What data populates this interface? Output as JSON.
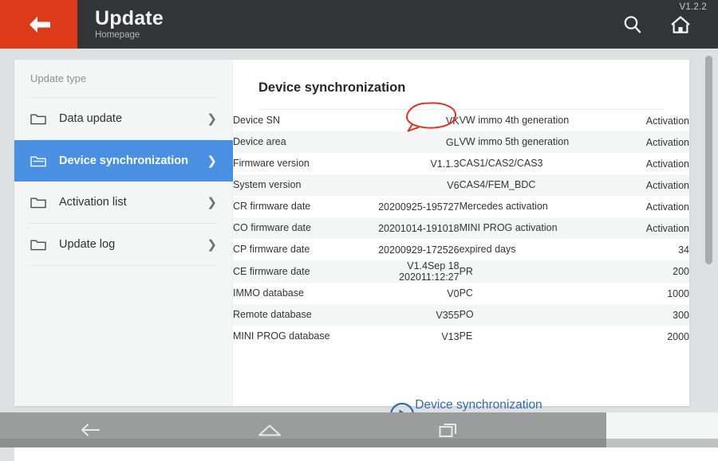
{
  "appbar": {
    "back_icon": "arrow-left-icon",
    "title": "Update",
    "subtitle": "Homepage",
    "version": "V1.2.2",
    "search_icon": "search-icon",
    "home_icon": "home-icon",
    "bar_color": "#333436",
    "back_color": "#dd3a19"
  },
  "sidebar": {
    "header": "Update type",
    "items": [
      {
        "label": "Data update",
        "icon": "folder-closed-icon",
        "chevron": "❯",
        "active": false
      },
      {
        "label": "Device synchronization",
        "icon": "folder-open-icon",
        "chevron": "❯",
        "active": true
      },
      {
        "label": "Activation list",
        "icon": "folder-closed-icon",
        "chevron": "❯",
        "active": false
      },
      {
        "label": "Update log",
        "icon": "folder-closed-icon",
        "chevron": "❯",
        "active": false
      }
    ],
    "active_color": "#4a90e2"
  },
  "content": {
    "title": "Device synchronization",
    "link_color": "#4a86c8",
    "rows": [
      {
        "key": "Device SN",
        "value": "VK",
        "value2": "",
        "right_key": "VW immo 4th generation",
        "right_value": "Activation",
        "masked": true
      },
      {
        "key": "Device area",
        "value": "GL",
        "value2": "",
        "right_key": "VW immo 5th generation",
        "right_value": "Activation"
      },
      {
        "key": "Firmware version",
        "value": "V1.1.3",
        "value2": "",
        "right_key": "CAS1/CAS2/CAS3",
        "right_value": "Activation"
      },
      {
        "key": "System version",
        "value": "V6",
        "value2": "",
        "right_key": "CAS4/FEM_BDC",
        "right_value": "Activation"
      },
      {
        "key": "CR firmware date",
        "value": "20200925-195727",
        "value2": "",
        "right_key": "Mercedes activation",
        "right_value": "Activation"
      },
      {
        "key": "CO firmware date",
        "value": "20201014-191018",
        "value2": "",
        "right_key": "MINI PROG activation",
        "right_value": "Activation"
      },
      {
        "key": "CP firmware date",
        "value": "20200929-172526",
        "value2": "",
        "right_key": "expired days",
        "right_value": "34"
      },
      {
        "key": "CE firmware date",
        "value": "V1.4Sep 18",
        "value2": "202011:12:27",
        "right_key": "PR",
        "right_value": "200"
      },
      {
        "key": "IMMO database",
        "value": "V0",
        "value2": "",
        "right_key": "PC",
        "right_value": "1000"
      },
      {
        "key": "Remote database",
        "value": "V355",
        "value2": "",
        "right_key": "PO",
        "right_value": "300"
      },
      {
        "key": "MINI PROG database",
        "value": "V13",
        "value2": "",
        "right_key": "PE",
        "right_value": "2000"
      }
    ]
  },
  "overlay": {
    "caption": "Device synchronization",
    "caption_color": "#2d6cb5",
    "play_icon": "play-circle-icon",
    "doc_icon": "document-search-icon",
    "wave_icon": "waveform-icon",
    "annotation_icon": "red-speech-bubble-annotation",
    "annotation_color": "#e03326"
  },
  "navbar": {
    "back_icon": "android-back-icon",
    "home_icon": "android-home-icon",
    "recents_icon": "android-recents-icon",
    "bar_color": "#9b9c9c"
  },
  "scrollbar": {
    "thumb_color": "#a9aaab"
  }
}
